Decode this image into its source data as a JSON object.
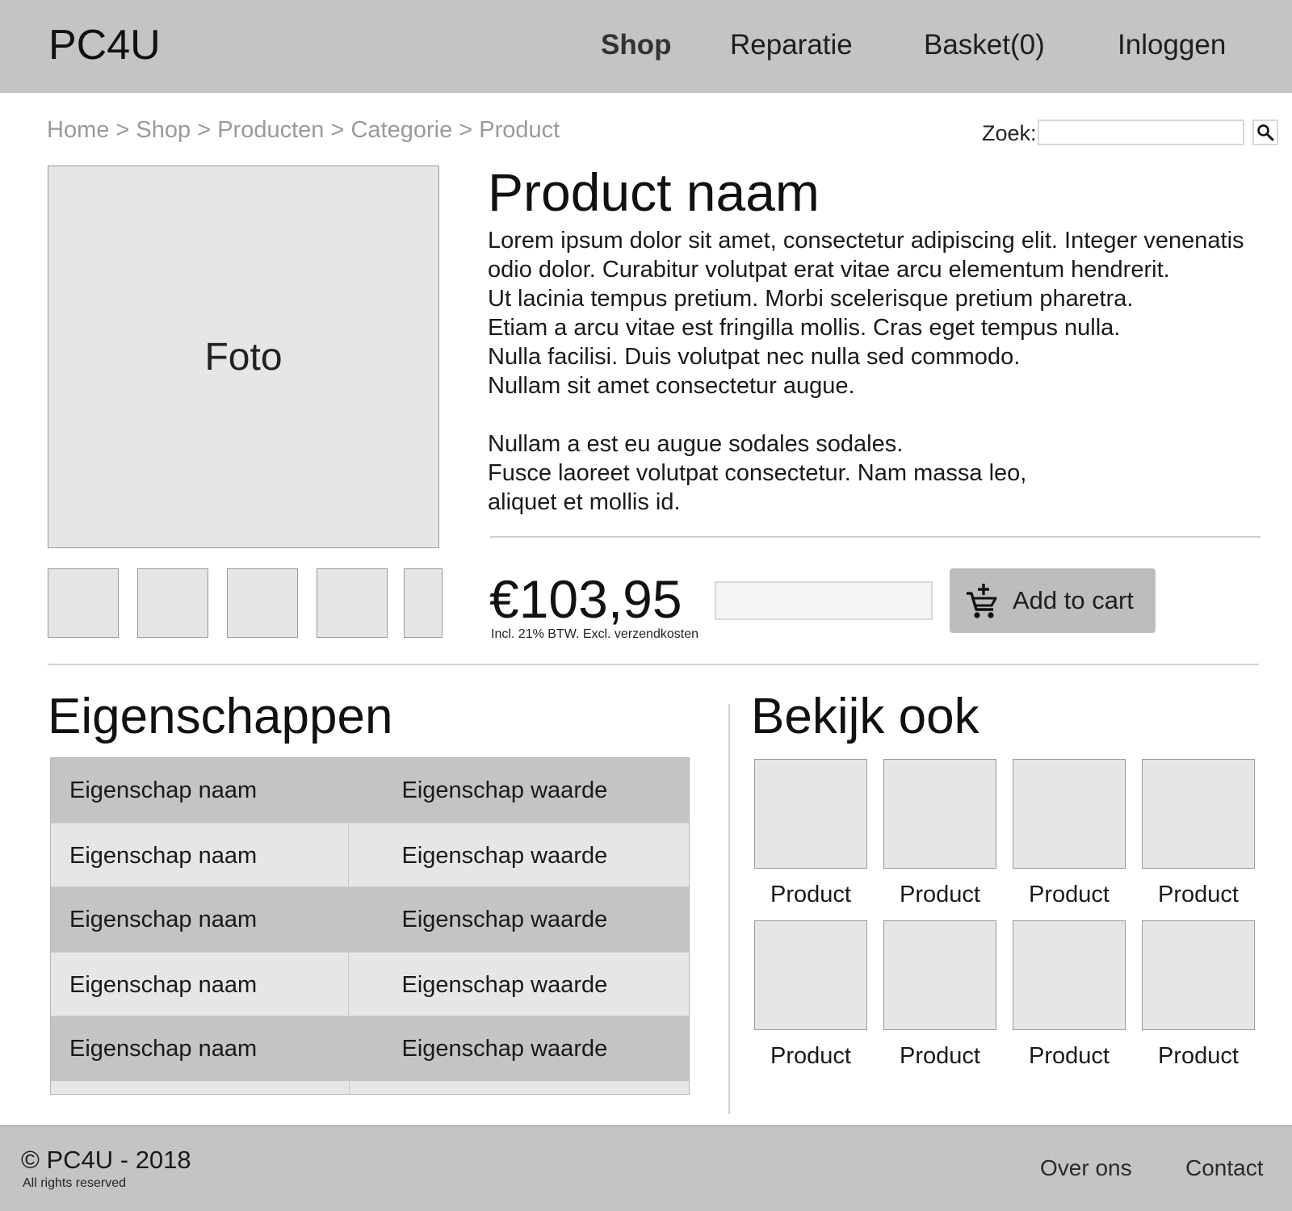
{
  "header": {
    "logo": "PC4U",
    "nav": {
      "shop": "Shop",
      "repair": "Reparatie",
      "basket": "Basket(0)",
      "login": "Inloggen"
    }
  },
  "breadcrumb": [
    "Home",
    "Shop",
    "Producten",
    "Categorie",
    "Product"
  ],
  "breadcrumb_separator": ">",
  "search": {
    "label": "Zoek:",
    "value": "",
    "icon": "search-icon"
  },
  "gallery": {
    "photo_label": "Foto",
    "thumbnail_count": 5
  },
  "product": {
    "name": "Product naam",
    "description_lines": [
      "Lorem ipsum dolor sit amet, consectetur adipiscing elit. Integer venenatis",
      "odio dolor. Curabitur volutpat erat vitae arcu elementum hendrerit.",
      "Ut lacinia tempus pretium. Morbi scelerisque pretium pharetra.",
      "Etiam a arcu vitae est fringilla mollis. Cras eget tempus nulla.",
      "Nulla facilisi. Duis volutpat nec nulla sed commodo.",
      "Nullam sit amet consectetur augue.",
      "",
      "Nullam a est eu augue sodales sodales.",
      "Fusce laoreet volutpat consectetur. Nam massa leo,",
      "aliquet et mollis id."
    ],
    "price": "€103,95",
    "price_note": "Incl. 21% BTW. Excl. verzendkosten",
    "quantity_value": "",
    "add_to_cart": "Add to cart",
    "cart_icon": "add-shopping-cart-icon"
  },
  "properties": {
    "title": "Eigenschappen",
    "rows": [
      {
        "name": "Eigenschap naam",
        "value": "Eigenschap waarde"
      },
      {
        "name": "Eigenschap naam",
        "value": "Eigenschap waarde"
      },
      {
        "name": "Eigenschap naam",
        "value": "Eigenschap waarde"
      },
      {
        "name": "Eigenschap naam",
        "value": "Eigenschap waarde"
      },
      {
        "name": "Eigenschap naam",
        "value": "Eigenschap waarde"
      }
    ]
  },
  "related": {
    "title": "Bekijk ook",
    "items": [
      "Product",
      "Product",
      "Product",
      "Product",
      "Product",
      "Product",
      "Product",
      "Product"
    ]
  },
  "footer": {
    "copyright": "© PC4U - 2018",
    "rights": "All rights reserved",
    "links": {
      "about": "Over ons",
      "contact": "Contact"
    }
  },
  "colors": {
    "header_bg": "#c4c4c4",
    "placeholder_bg": "#e6e6e6",
    "button_bg": "#bdbdbd"
  }
}
